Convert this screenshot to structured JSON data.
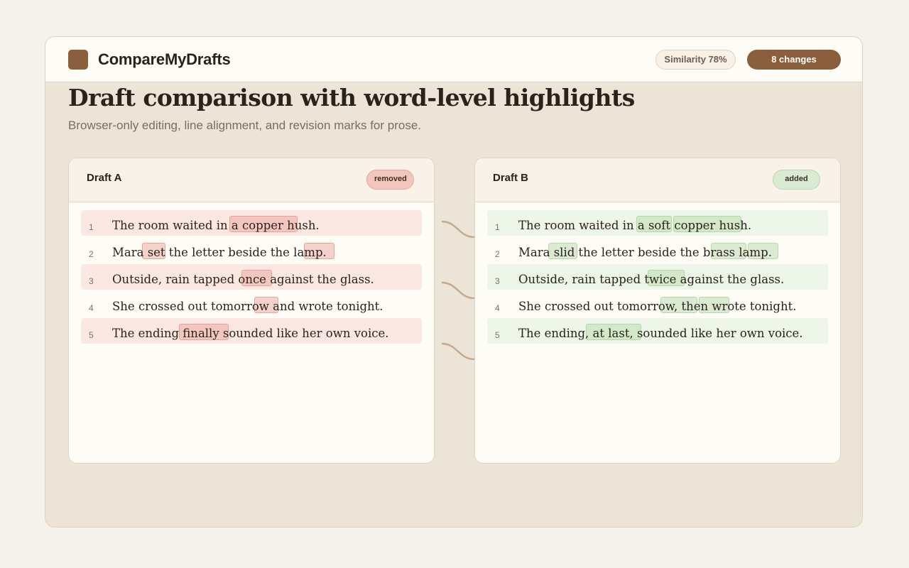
{
  "app": {
    "name": "CompareMyDrafts",
    "similarity": "Similarity 78%",
    "changes": "8 changes"
  },
  "page": {
    "title": "Draft comparison with word-level highlights",
    "subtitle": "Browser-only editing, line alignment, and revision marks for prose."
  },
  "draft_a": {
    "title": "Draft A",
    "tag": "removed",
    "lines": [
      {
        "n": "1",
        "text": "The room waited in a copper hush."
      },
      {
        "n": "2",
        "text": "Mara set the letter beside the lamp."
      },
      {
        "n": "3",
        "text": "Outside, rain tapped once against the glass."
      },
      {
        "n": "4",
        "text": "She crossed out tomorrow and wrote tonight."
      },
      {
        "n": "5",
        "text": "The ending finally sounded like her own voice."
      }
    ]
  },
  "draft_b": {
    "title": "Draft B",
    "tag": "added",
    "lines": [
      {
        "n": "1",
        "text": "The room waited in a soft copper hush."
      },
      {
        "n": "2",
        "text": "Mara slid the letter beside the brass lamp."
      },
      {
        "n": "3",
        "text": "Outside, rain tapped twice against the glass."
      },
      {
        "n": "4",
        "text": "She crossed out tomorrow, then wrote tonight."
      },
      {
        "n": "5",
        "text": "The ending, at last, sounded like her own voice."
      }
    ]
  },
  "colors": {
    "accent": "#8b5e3c",
    "removed": "#f2c6bd",
    "added": "#d9ecd3"
  }
}
